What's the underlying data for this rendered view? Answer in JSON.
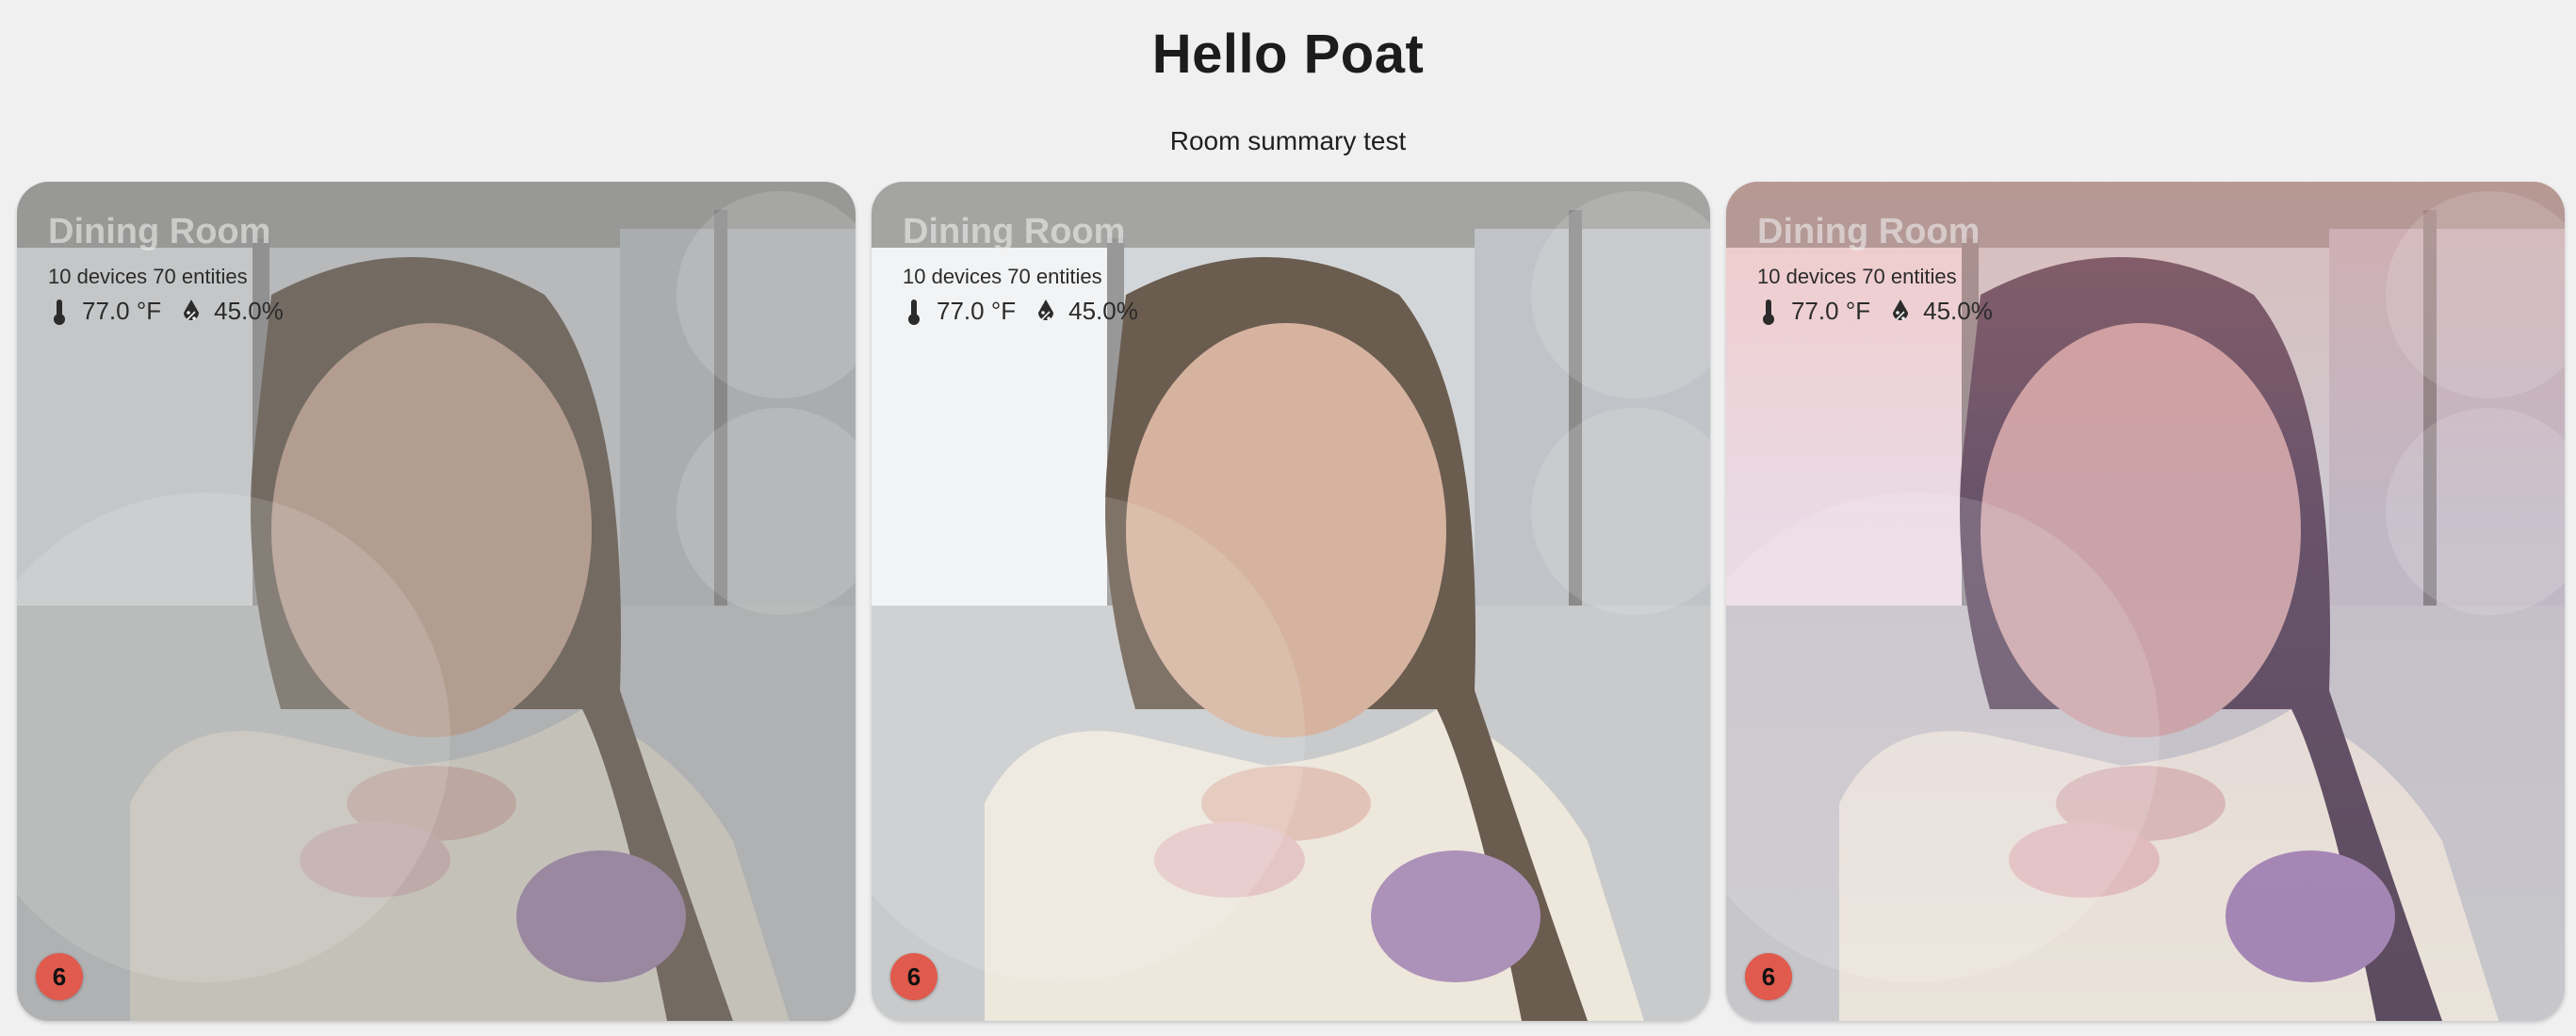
{
  "header": {
    "title": "Hello Poat",
    "subtitle": "Room summary test"
  },
  "cards": [
    {
      "name": "Dining Room",
      "counts": "10 devices 70 entities",
      "temperature": "77.0 °F",
      "humidity": "45.0%",
      "badge": "6"
    },
    {
      "name": "Dining Room",
      "counts": "10 devices 70 entities",
      "temperature": "77.0 °F",
      "humidity": "45.0%",
      "badge": "6"
    },
    {
      "name": "Dining Room",
      "counts": "10 devices 70 entities",
      "temperature": "77.0 °F",
      "humidity": "45.0%",
      "badge": "6"
    }
  ],
  "icons": {
    "temperature": "thermometer-icon",
    "humidity": "water-percent-icon"
  },
  "colors": {
    "badge": "#e05a4d",
    "background": "#f0f0f0"
  }
}
